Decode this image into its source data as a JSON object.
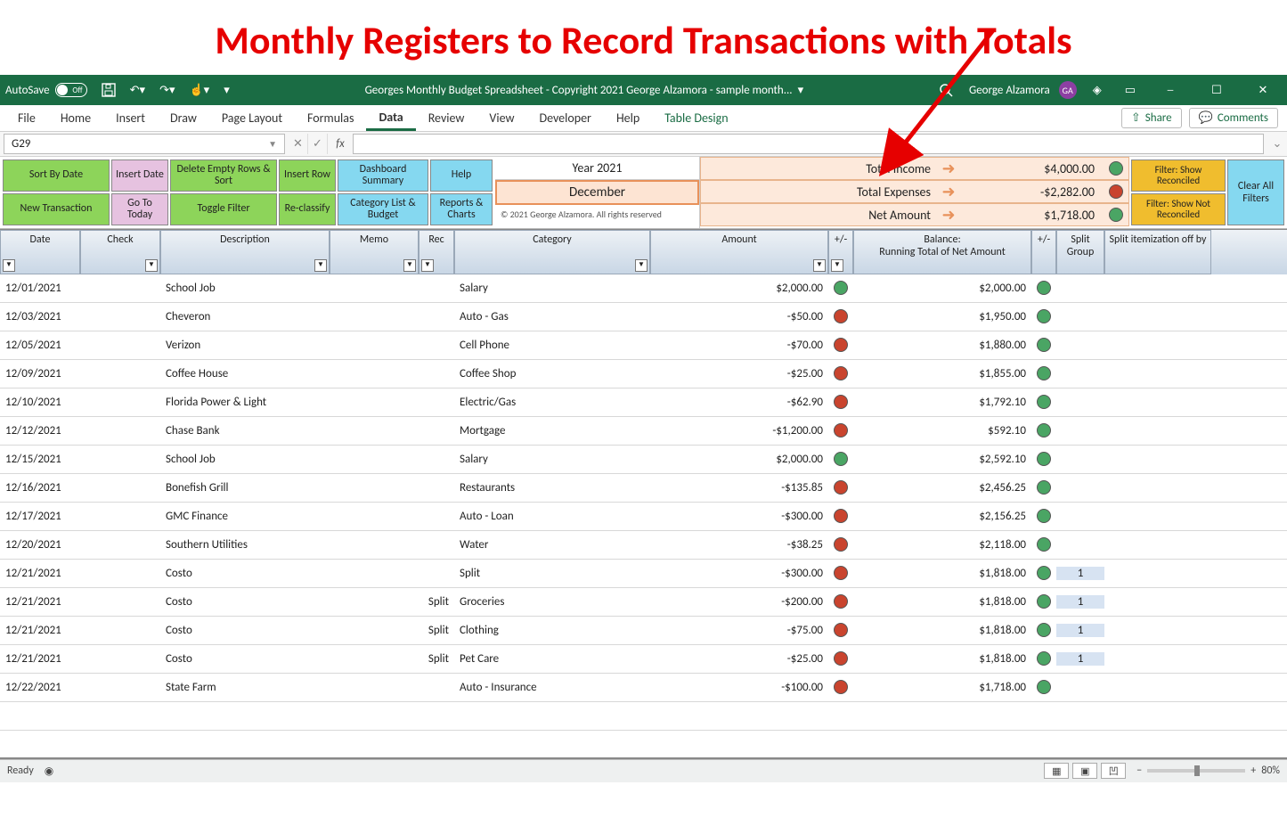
{
  "annotation": "Monthly Registers to Record Transactions with Totals",
  "titlebar": {
    "autosave_label": "AutoSave",
    "autosave_state": "Off",
    "document_title": "Georges Monthly Budget Spreadsheet - Copyright 2021 George Alzamora - sample month...",
    "user_name": "George Alzamora",
    "user_initials": "GA"
  },
  "ribbon": {
    "tabs": [
      "File",
      "Home",
      "Insert",
      "Draw",
      "Page Layout",
      "Formulas",
      "Data",
      "Review",
      "View",
      "Developer",
      "Help",
      "Table Design"
    ],
    "active_tab": "Data",
    "share": "Share",
    "comments": "Comments"
  },
  "formula_bar": {
    "name_box": "G29",
    "formula": ""
  },
  "toolbar": {
    "row1": [
      "Sort By Date",
      "Insert Date",
      "Delete Empty Rows & Sort",
      "Insert Row",
      "Dashboard Summary",
      "Help"
    ],
    "row2": [
      "New Transaction",
      "Go To Today",
      "Toggle Filter",
      "Re-classify",
      "Category List & Budget",
      "Reports & Charts"
    ],
    "row1_colors": [
      "green",
      "pink",
      "green",
      "green",
      "blue",
      "blue"
    ],
    "row2_colors": [
      "green",
      "pink",
      "green",
      "green",
      "blue",
      "blue"
    ],
    "filter_show_reconciled": "Filter: Show Reconciled",
    "filter_show_not_reconciled": "Filter: Show Not Reconciled",
    "clear_all": "Clear All Filters"
  },
  "summary": {
    "year": "Year 2021",
    "month": "December",
    "copyright": "© 2021 George Alzamora. All rights reserved",
    "rows": [
      {
        "label": "Total Income",
        "value": "$4,000.00",
        "dot": "green"
      },
      {
        "label": "Total Expenses",
        "value": "-$2,282.00",
        "dot": "red"
      },
      {
        "label": "Net Amount",
        "value": "$1,718.00",
        "dot": "green"
      }
    ]
  },
  "table": {
    "headers": [
      "Date",
      "Check",
      "Description",
      "Memo",
      "Rec",
      "Category",
      "Amount",
      "+/-",
      "Balance:\nRunning Total of Net Amount",
      "+/-",
      "Split Group",
      "Split itemization off by"
    ],
    "rows": [
      {
        "date": "12/01/2021",
        "desc": "School Job",
        "memo": "",
        "rec": "",
        "cat": "Salary",
        "amount": "$2,000.00",
        "dot1": "green",
        "balance": "$2,000.00",
        "dot2": "green",
        "split": "",
        "off": ""
      },
      {
        "date": "12/03/2021",
        "desc": "Cheveron",
        "memo": "",
        "rec": "",
        "cat": "Auto - Gas",
        "amount": "-$50.00",
        "dot1": "red",
        "balance": "$1,950.00",
        "dot2": "green",
        "split": "",
        "off": ""
      },
      {
        "date": "12/05/2021",
        "desc": "Verizon",
        "memo": "",
        "rec": "",
        "cat": "Cell Phone",
        "amount": "-$70.00",
        "dot1": "red",
        "balance": "$1,880.00",
        "dot2": "green",
        "split": "",
        "off": ""
      },
      {
        "date": "12/09/2021",
        "desc": "Coffee House",
        "memo": "",
        "rec": "",
        "cat": "Coffee Shop",
        "amount": "-$25.00",
        "dot1": "red",
        "balance": "$1,855.00",
        "dot2": "green",
        "split": "",
        "off": ""
      },
      {
        "date": "12/10/2021",
        "desc": "Florida Power & Light",
        "memo": "",
        "rec": "",
        "cat": "Electric/Gas",
        "amount": "-$62.90",
        "dot1": "red",
        "balance": "$1,792.10",
        "dot2": "green",
        "split": "",
        "off": ""
      },
      {
        "date": "12/12/2021",
        "desc": "Chase Bank",
        "memo": "",
        "rec": "",
        "cat": "Mortgage",
        "amount": "-$1,200.00",
        "dot1": "red",
        "balance": "$592.10",
        "dot2": "green",
        "split": "",
        "off": ""
      },
      {
        "date": "12/15/2021",
        "desc": "School Job",
        "memo": "",
        "rec": "",
        "cat": "Salary",
        "amount": "$2,000.00",
        "dot1": "green",
        "balance": "$2,592.10",
        "dot2": "green",
        "split": "",
        "off": ""
      },
      {
        "date": "12/16/2021",
        "desc": "Bonefish Grill",
        "memo": "",
        "rec": "",
        "cat": "Restaurants",
        "amount": "-$135.85",
        "dot1": "red",
        "balance": "$2,456.25",
        "dot2": "green",
        "split": "",
        "off": ""
      },
      {
        "date": "12/17/2021",
        "desc": "GMC Finance",
        "memo": "",
        "rec": "",
        "cat": "Auto - Loan",
        "amount": "-$300.00",
        "dot1": "red",
        "balance": "$2,156.25",
        "dot2": "green",
        "split": "",
        "off": ""
      },
      {
        "date": "12/20/2021",
        "desc": "Southern Utilities",
        "memo": "",
        "rec": "",
        "cat": "Water",
        "amount": "-$38.25",
        "dot1": "red",
        "balance": "$2,118.00",
        "dot2": "green",
        "split": "",
        "off": ""
      },
      {
        "date": "12/21/2021",
        "desc": "Costo",
        "memo": "",
        "rec": "",
        "cat": "Split",
        "amount": "-$300.00",
        "dot1": "red",
        "balance": "$1,818.00",
        "dot2": "green",
        "split": "1",
        "off": ""
      },
      {
        "date": "12/21/2021",
        "desc": "Costo",
        "memo": "",
        "rec": "Split",
        "cat": "Groceries",
        "amount": "-$200.00",
        "dot1": "red",
        "balance": "$1,818.00",
        "dot2": "green",
        "split": "1",
        "off": ""
      },
      {
        "date": "12/21/2021",
        "desc": "Costo",
        "memo": "",
        "rec": "Split",
        "cat": "Clothing",
        "amount": "-$75.00",
        "dot1": "red",
        "balance": "$1,818.00",
        "dot2": "green",
        "split": "1",
        "off": ""
      },
      {
        "date": "12/21/2021",
        "desc": "Costo",
        "memo": "",
        "rec": "Split",
        "cat": "Pet Care",
        "amount": "-$25.00",
        "dot1": "red",
        "balance": "$1,818.00",
        "dot2": "green",
        "split": "1",
        "off": ""
      },
      {
        "date": "12/22/2021",
        "desc": "State Farm",
        "memo": "",
        "rec": "",
        "cat": "Auto - Insurance",
        "amount": "-$100.00",
        "dot1": "red",
        "balance": "$1,718.00",
        "dot2": "green",
        "split": "",
        "off": ""
      }
    ]
  },
  "statusbar": {
    "ready": "Ready",
    "zoom": "80%"
  }
}
